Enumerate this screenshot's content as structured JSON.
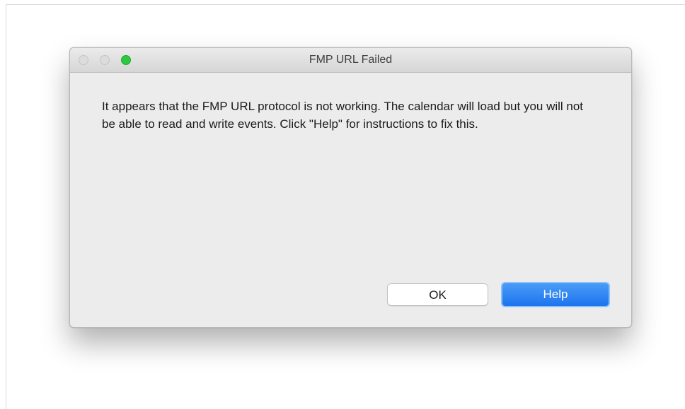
{
  "dialog": {
    "title": "FMP URL Failed",
    "message": "It appears that the FMP URL protocol is not working. The calendar will load but you will not be able to read and write events. Click \"Help\" for instructions to fix this.",
    "buttons": {
      "ok_label": "OK",
      "help_label": "Help"
    },
    "window_controls": {
      "close_icon": "close-icon",
      "minimize_icon": "minimize-icon",
      "zoom_icon": "zoom-icon"
    }
  },
  "colors": {
    "accent": "#1d75ee",
    "zoom_green": "#2bc840",
    "dialog_bg": "#ececec"
  }
}
